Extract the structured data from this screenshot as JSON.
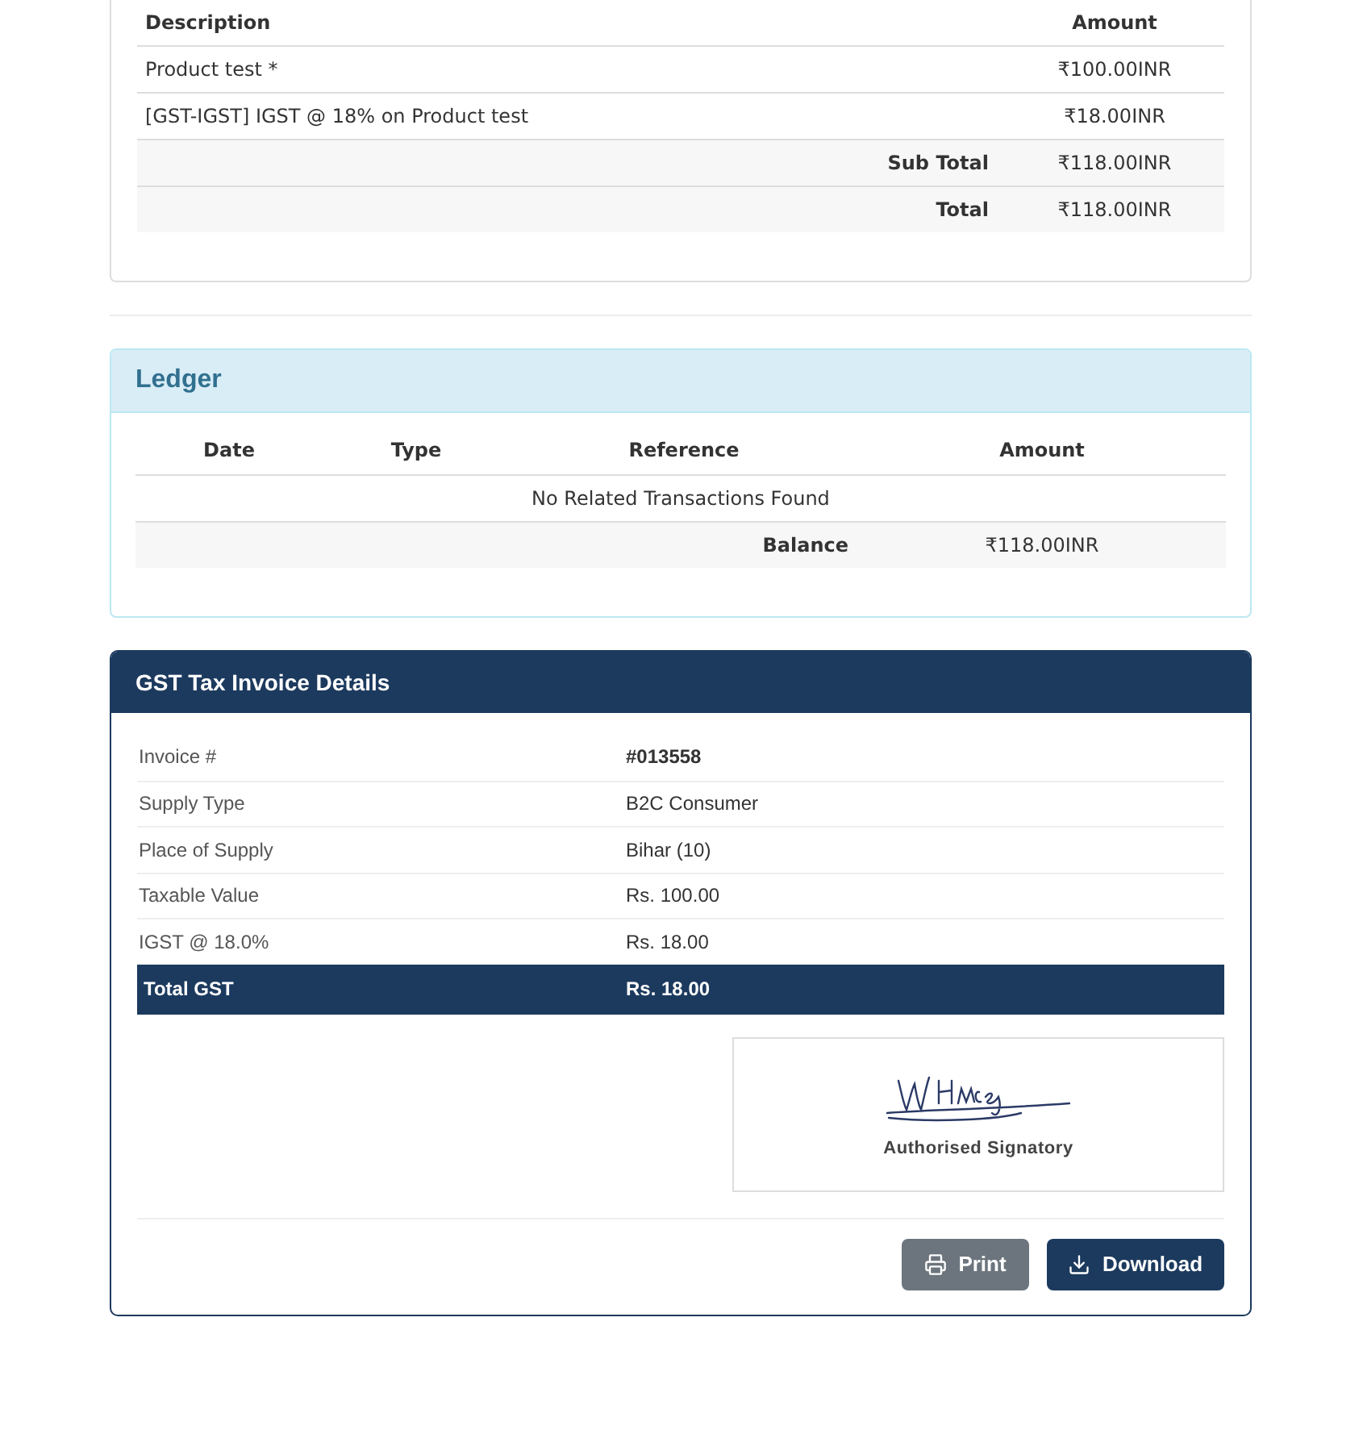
{
  "invoice_items": {
    "columns": [
      "Description",
      "Amount"
    ],
    "rows": [
      {
        "description": "Product test *",
        "amount": "₹100.00INR"
      },
      {
        "description": "[GST-IGST] IGST @ 18% on Product test",
        "amount": "₹18.00INR"
      }
    ],
    "totals": [
      {
        "label": "Sub Total",
        "amount": "₹118.00INR"
      },
      {
        "label": "Total",
        "amount": "₹118.00INR"
      }
    ]
  },
  "ledger": {
    "title": "Ledger",
    "columns": [
      "Date",
      "Type",
      "Reference",
      "Amount"
    ],
    "empty_message": "No Related Transactions Found",
    "balance": {
      "label": "Balance",
      "amount": "₹118.00INR"
    }
  },
  "gst_details": {
    "title": "GST Tax Invoice Details",
    "rows": [
      {
        "label": "Invoice #",
        "value": "#013558",
        "bold": true
      },
      {
        "label": "Supply Type",
        "value": "B2C Consumer",
        "bold": false
      },
      {
        "label": "Place of Supply",
        "value": "Bihar (10)",
        "bold": false
      },
      {
        "label": "Taxable Value",
        "value": "Rs. 100.00",
        "bold": false
      },
      {
        "label": "IGST @ 18.0%",
        "value": "Rs. 18.00",
        "bold": false
      }
    ],
    "total": {
      "label": "Total GST",
      "value": "Rs. 18.00"
    },
    "signature": {
      "caption": "Authorised Signatory"
    },
    "buttons": [
      {
        "label": "Print",
        "kind": "secondary"
      },
      {
        "label": "Download",
        "kind": "primary"
      }
    ]
  }
}
